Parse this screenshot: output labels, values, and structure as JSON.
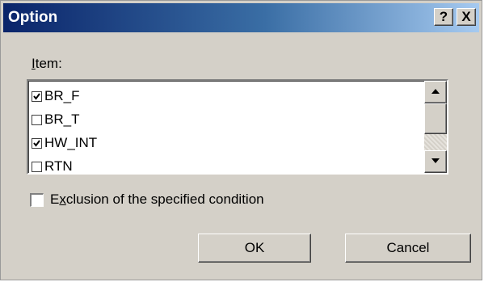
{
  "window": {
    "title": "Option",
    "help_label": "?",
    "close_label": "X"
  },
  "item_label": {
    "accel": "I",
    "rest": "tem:"
  },
  "items": [
    {
      "label": "BR_F",
      "checked": true
    },
    {
      "label": "BR_T",
      "checked": false
    },
    {
      "label": "HW_INT",
      "checked": true
    },
    {
      "label": "RTN",
      "checked": false
    }
  ],
  "exclusion": {
    "pre": "E",
    "accel": "x",
    "rest": "clusion of the specified condition",
    "checked": false
  },
  "buttons": {
    "ok": "OK",
    "cancel": "Cancel"
  }
}
